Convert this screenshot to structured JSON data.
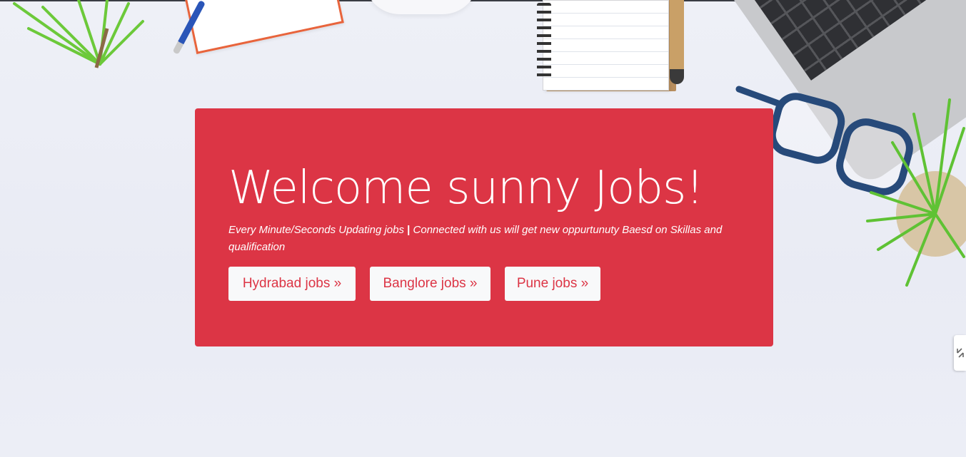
{
  "hero": {
    "title": "Welcome sunny Jobs!",
    "subtitle_part1": "Every Minute/Seconds Updating jobs",
    "subtitle_separator": "|",
    "subtitle_part2": "Connected with us will get new oppurtunuty Baesd on Skillas and qualification",
    "background_color": "#dc3545"
  },
  "buttons": {
    "hydrabad": "Hydrabad jobs »",
    "banglore": "Banglore jobs »",
    "pune": "Pune jobs »"
  },
  "side_widget": {
    "icon": "collapse-arrows-icon"
  },
  "colors": {
    "accent": "#dc3545",
    "button_bg": "#f8f9fa"
  }
}
